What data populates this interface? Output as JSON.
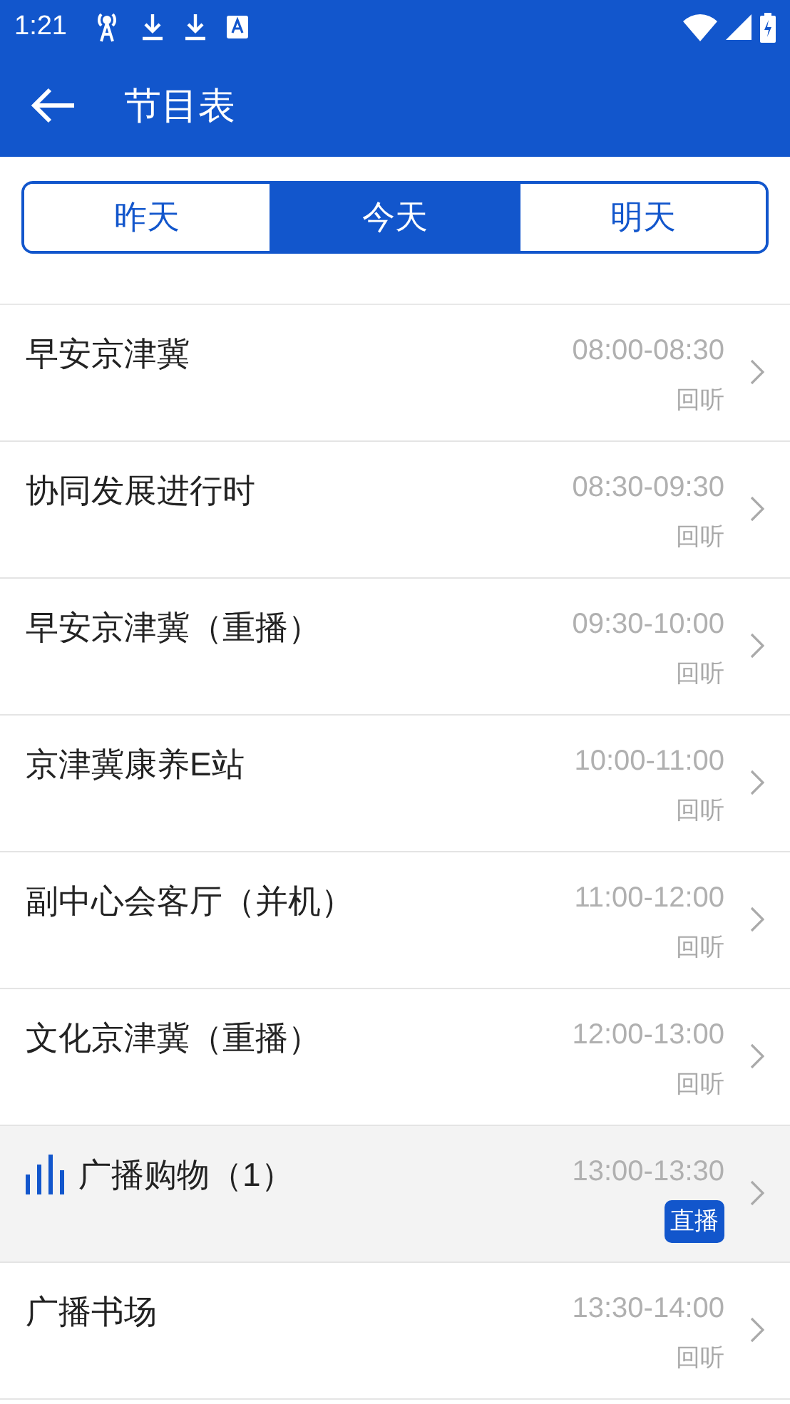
{
  "status_bar": {
    "time": "1:21"
  },
  "app_bar": {
    "title": "节目表"
  },
  "tabs": [
    {
      "label": "昨天",
      "selected": false
    },
    {
      "label": "今天",
      "selected": true
    },
    {
      "label": "明天",
      "selected": false
    }
  ],
  "programs": [
    {
      "name": "早安京津冀",
      "time": "08:00-08:30",
      "tag": "回听",
      "live": false
    },
    {
      "name": "协同发展进行时",
      "time": "08:30-09:30",
      "tag": "回听",
      "live": false
    },
    {
      "name": "早安京津冀（重播）",
      "time": "09:30-10:00",
      "tag": "回听",
      "live": false
    },
    {
      "name": "京津冀康养E站",
      "time": "10:00-11:00",
      "tag": "回听",
      "live": false
    },
    {
      "name": "副中心会客厅（并机）",
      "time": "11:00-12:00",
      "tag": "回听",
      "live": false
    },
    {
      "name": "文化京津冀（重播）",
      "time": "12:00-13:00",
      "tag": "回听",
      "live": false
    },
    {
      "name": "广播购物（1）",
      "time": "13:00-13:30",
      "tag": "直播",
      "live": true
    },
    {
      "name": "广播书场",
      "time": "13:30-14:00",
      "tag": "回听",
      "live": false
    }
  ]
}
